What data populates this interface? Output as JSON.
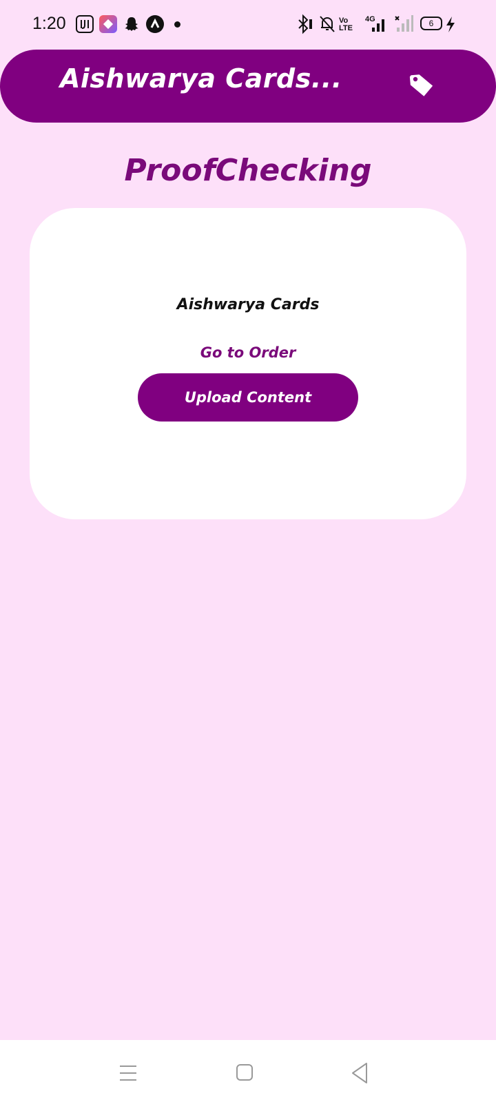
{
  "status_bar": {
    "time": "1:20",
    "battery": "6",
    "network": "4G",
    "volte": "Vo LTE",
    "icons": [
      "jiosaavn-icon",
      "app-icon",
      "snapchat-icon",
      "alert-app-icon",
      "dot-icon",
      "bluetooth-icon",
      "mute-icon",
      "volte-icon",
      "signal-icon",
      "no-signal-icon",
      "battery-icon",
      "charging-icon"
    ]
  },
  "app_bar": {
    "title": "Aishwarya Cards...",
    "action_icon": "tag-icon"
  },
  "page": {
    "title": "ProofChecking"
  },
  "card": {
    "name": "Aishwarya Cards",
    "link_label": "Go to Order",
    "button_label": "Upload Content"
  },
  "nav_bar": {
    "icons": [
      "menu-icon",
      "home-icon",
      "back-icon"
    ]
  },
  "colors": {
    "background": "#fde0f9",
    "primary": "#800080",
    "card": "#ffffff"
  }
}
